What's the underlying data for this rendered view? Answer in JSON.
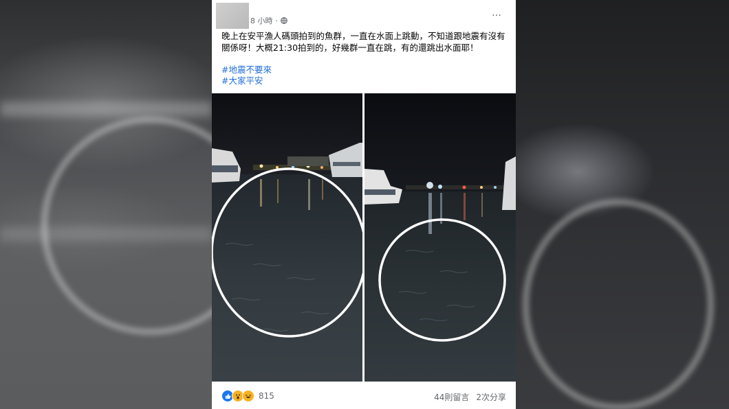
{
  "post": {
    "timestamp": "8 小時",
    "body_text": "晚上在安平漁人碼頭拍到的魚群，一直在水面上跳動，不知道跟地震有沒有關係呀！大概21:30拍到的，好幾群一直在跳，有的還跳出水面耶！",
    "hashtags": [
      "#地震不要來",
      "#大家平安"
    ],
    "more_icon": "…"
  },
  "photos": [
    {
      "name": "harbor-photo-left",
      "icon": "night-harbor-photo"
    },
    {
      "name": "harbor-photo-right",
      "icon": "night-harbor-photo"
    }
  ],
  "footer": {
    "reaction_icons": [
      "like-icon",
      "wow-icon",
      "haha-icon"
    ],
    "reaction_count": "815",
    "comments": "44則留言",
    "shares": "2次分享"
  },
  "colors": {
    "link": "#216fdb",
    "like": "#1877f2",
    "emoji": "#f7b125"
  }
}
